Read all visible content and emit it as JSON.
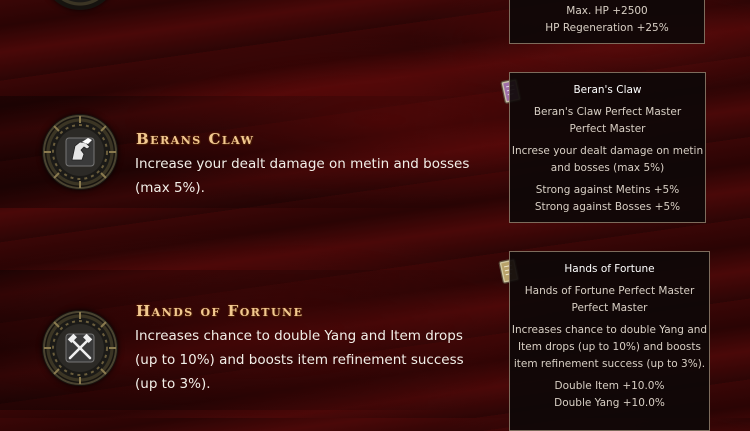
{
  "top_tooltip": {
    "lines": [
      "Max. HP +2500",
      "HP Regeneration +25%"
    ]
  },
  "skills": [
    {
      "title": "Berans Claw",
      "description": "Increase your dealt damage on metin and bosses (max 5%).",
      "icon": "beast-claw-icon"
    },
    {
      "title": "Hands of Fortune",
      "description": "Increases chance to double Yang and Item drops (up to 10%) and boosts item refinement success (up to 3%).",
      "icon": "crossed-hammers-icon"
    }
  ],
  "tooltips": [
    {
      "icon": "skill-book-icon",
      "title": "Beran's Claw",
      "level": "Beran's Claw Perfect Master",
      "rank": "Perfect Master",
      "desc_line1": "Increse your dealt damage on metin",
      "desc_line2": "and bosses (max 5%)",
      "bonus1": "Strong against Metins +5%",
      "bonus2": "Strong against Bosses +5%"
    },
    {
      "icon": "skill-book-icon",
      "title": "Hands of Fortune",
      "level": "Hands of Fortune Perfect Master",
      "rank": "Perfect Master",
      "desc_line1": "Increases chance to double Yang and",
      "desc_line2": "Item drops (up to 10%) and boosts",
      "desc_line3": "item refinement success (up to 3%).",
      "bonus1": "Double Item +10.0%",
      "bonus2": "Double Yang +10.0%"
    }
  ],
  "colors": {
    "title_gold": "#f2c990",
    "tooltip_border": "#7d6c5c",
    "background_red": "#3a0606"
  }
}
